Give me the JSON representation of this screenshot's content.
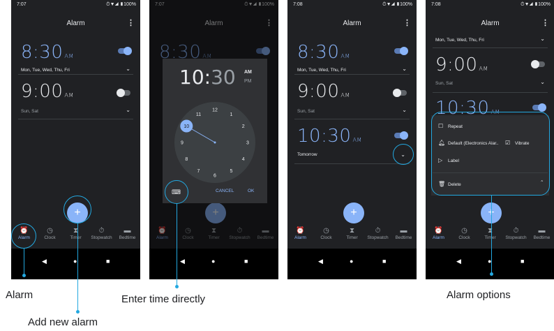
{
  "status": {
    "time_a": "7:07",
    "time_b": "7:08",
    "battery": "⏱▼◢ ▮100%"
  },
  "title": "Alarm",
  "more": "⋮",
  "alarms": {
    "a830": {
      "hm": "8:30",
      "ampm": "AM",
      "days": "Mon, Tue, Wed, Thu, Fri"
    },
    "a900": {
      "hm": "9:00",
      "ampm": "AM",
      "days": "Sun, Sat"
    },
    "a1030": {
      "hm": "10:30",
      "ampm": "AM",
      "days": "Tomorrow"
    }
  },
  "chevron_down": "⌄",
  "chevron_up": "⌃",
  "fab_label": "+",
  "tabs": [
    {
      "label": "Alarm",
      "icon": "⏰"
    },
    {
      "label": "Clock",
      "icon": "◷"
    },
    {
      "label": "Timer",
      "icon": "⧗"
    },
    {
      "label": "Stopwatch",
      "icon": "⏱"
    },
    {
      "label": "Bedtime",
      "icon": "▬"
    }
  ],
  "sysnav": {
    "back": "◀",
    "home": "●",
    "recents": "■"
  },
  "picker": {
    "hour": "10",
    "colon": ":",
    "minute": "30",
    "am": "AM",
    "pm": "PM",
    "dial": [
      "12",
      "1",
      "2",
      "3",
      "4",
      "5",
      "6",
      "7",
      "8",
      "9",
      "10",
      "11"
    ],
    "selected_hour": "10",
    "keyboard_icon": "⌨",
    "cancel": "CANCEL",
    "ok": "OK"
  },
  "options": {
    "repeat": "Repeat",
    "sound": "Default (Electronics Alar..",
    "vibrate": "Vibrate",
    "label": "Label",
    "delete": "Delete"
  },
  "callouts": {
    "alarm": "Alarm",
    "add": "Add new alarm",
    "enter": "Enter time directly",
    "options": "Alarm options"
  },
  "colors": {
    "accent": "#8ab4f8",
    "background": "#202124",
    "callout": "#23a8e0"
  }
}
